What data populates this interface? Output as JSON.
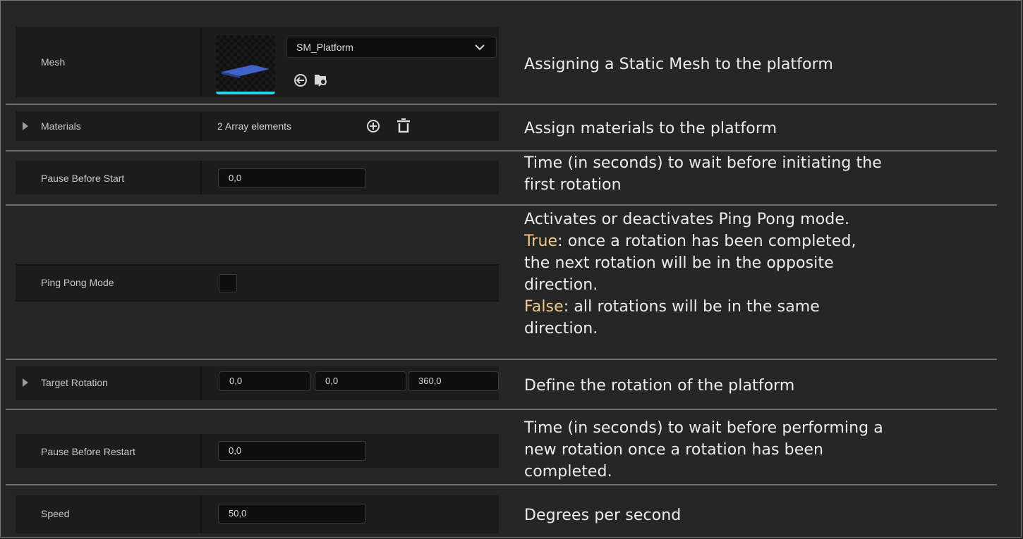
{
  "rows": {
    "mesh": {
      "label": "Mesh",
      "asset_name": "SM_Platform",
      "icons": [
        "dropdown-chevron-icon",
        "use-selected-icon",
        "browse-asset-icon"
      ],
      "description": "Assigning a Static Mesh to the platform"
    },
    "materials": {
      "label": "Materials",
      "value": "2 Array elements",
      "icons": [
        "add-element-icon",
        "delete-all-icon"
      ],
      "description": "Assign materials to the platform"
    },
    "pause_before_start": {
      "label": "Pause Before Start",
      "value": "0,0",
      "description_1": "Time (in seconds) to wait before initiating the",
      "description_2": "first rotation"
    },
    "ping_pong_mode": {
      "label": "Ping Pong Mode",
      "checked": false,
      "line1": "Activates or deactivates Ping Pong mode.",
      "true_kw": "True",
      "true_text": ": once a rotation has been completed,",
      "line3": "the next rotation will be in the opposite",
      "line4": "direction.",
      "false_kw": "False",
      "false_text": ": all rotations will be in the same",
      "line6": "direction."
    },
    "target_rotation": {
      "label": "Target Rotation",
      "x": "0,0",
      "y": "0,0",
      "z": "360,0",
      "description": "Define the rotation of the platform"
    },
    "pause_before_restart": {
      "label": "Pause Before Restart",
      "value": "0,0",
      "description_1": "Time (in seconds) to wait before performing a",
      "description_2": "new rotation once a rotation has been",
      "description_3": "completed."
    },
    "speed": {
      "label": "Speed",
      "value": "50,0",
      "description": "Degrees per second"
    }
  },
  "colors": {
    "background": "#262626",
    "panel": "#1c1c1c",
    "input": "#0f0f0f",
    "keyword": "#f2c98a",
    "thumbnail_accent": "#2ad4e6"
  }
}
